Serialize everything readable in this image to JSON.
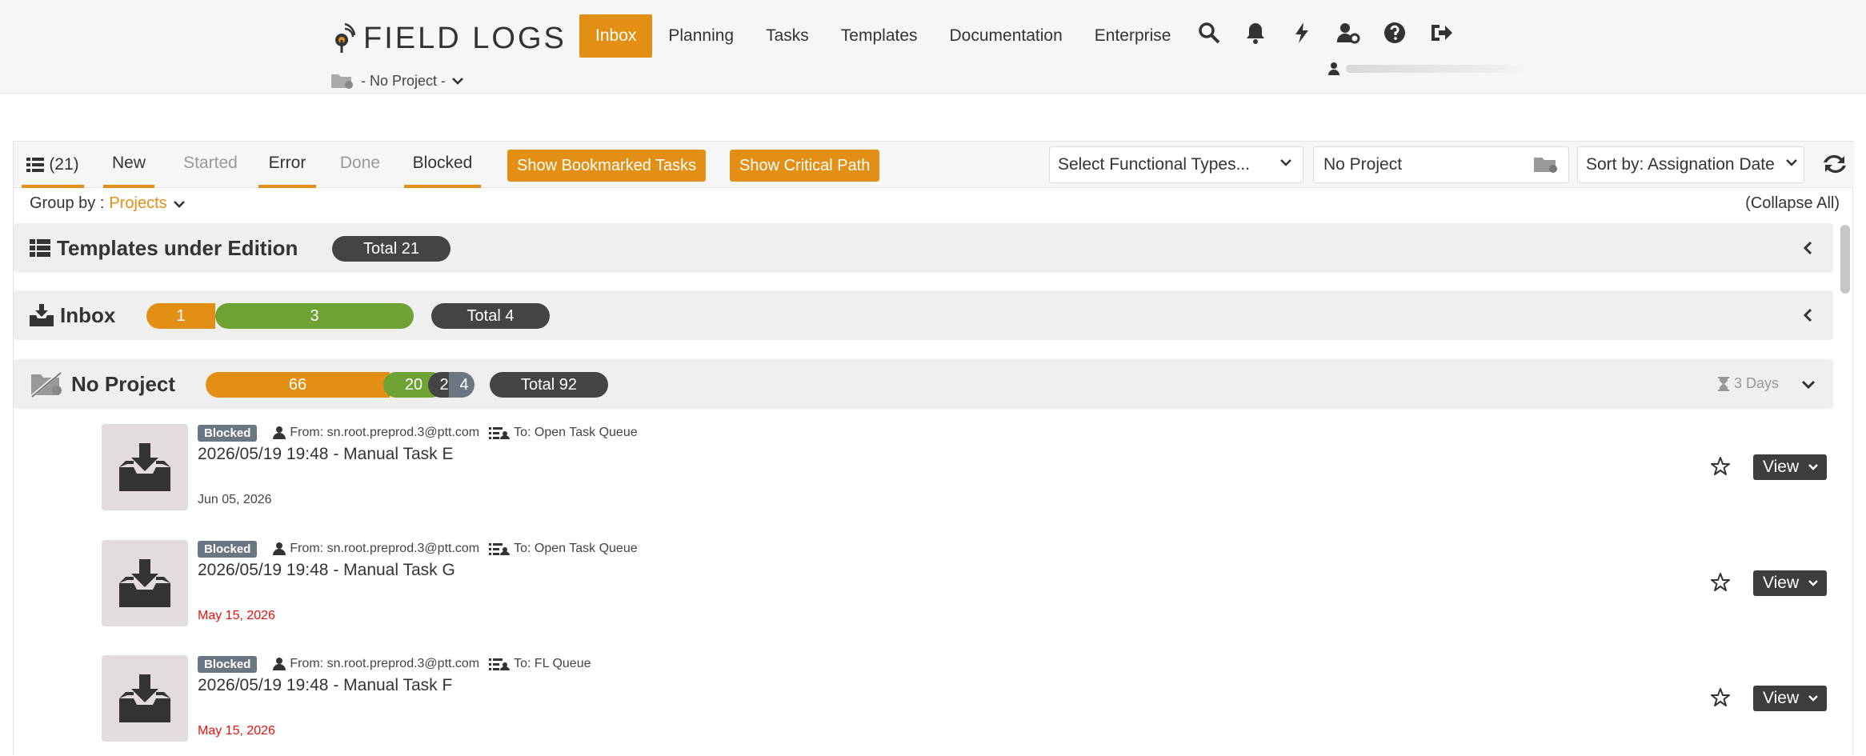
{
  "brand": {
    "name": "FIELD LOGS"
  },
  "project_picker": {
    "label": "- No Project -"
  },
  "nav": {
    "items": [
      "Inbox",
      "Planning",
      "Tasks",
      "Templates",
      "Documentation",
      "Enterprise"
    ],
    "active": "Inbox",
    "icons": [
      "search-icon",
      "bell-icon",
      "bolt-icon",
      "user-cog-icon",
      "help-icon",
      "sign-out-icon"
    ]
  },
  "toolbar": {
    "all_count": "(21)",
    "tabs": [
      "New",
      "Started",
      "Error",
      "Done",
      "Blocked"
    ],
    "bookmarked_button": "Show Bookmarked Tasks",
    "critical_path_button": "Show Critical Path",
    "functional_types_placeholder": "Select Functional Types...",
    "project_field": "No Project",
    "sort_label": "Sort by: Assignation Date"
  },
  "groupby": {
    "label": "Group by :",
    "value": "Projects"
  },
  "collapse_all": "(Collapse All)",
  "groups": [
    {
      "title": "Templates under Edition",
      "total": "Total 21"
    },
    {
      "title": "Inbox",
      "segments": [
        "1",
        "3"
      ],
      "total": "Total 4"
    },
    {
      "title": "No Project",
      "segments": [
        "66",
        "20",
        "2",
        "4"
      ],
      "total": "Total 92",
      "duration": "3 Days"
    }
  ],
  "tasks": [
    {
      "status": "Blocked",
      "from": "From: sn.root.preprod.3@ptt.com",
      "to": "To: Open Task Queue",
      "title": "2026/05/19 19:48 - Manual Task E",
      "date": "Jun 05, 2026",
      "overdue": false,
      "action": "View"
    },
    {
      "status": "Blocked",
      "from": "From: sn.root.preprod.3@ptt.com",
      "to": "To: Open Task Queue",
      "title": "2026/05/19 19:48 - Manual Task G",
      "date": "May 15, 2026",
      "overdue": true,
      "action": "View"
    },
    {
      "status": "Blocked",
      "from": "From: sn.root.preprod.3@ptt.com",
      "to": "To: FL Queue",
      "title": "2026/05/19 19:48 - Manual Task F",
      "date": "May 15, 2026",
      "overdue": true,
      "action": "View"
    }
  ],
  "colors": {
    "accent": "#e38f15",
    "started": "#6ea232",
    "dark": "#444444",
    "grey_blue": "#6b7683",
    "overdue": "#e8120c"
  }
}
